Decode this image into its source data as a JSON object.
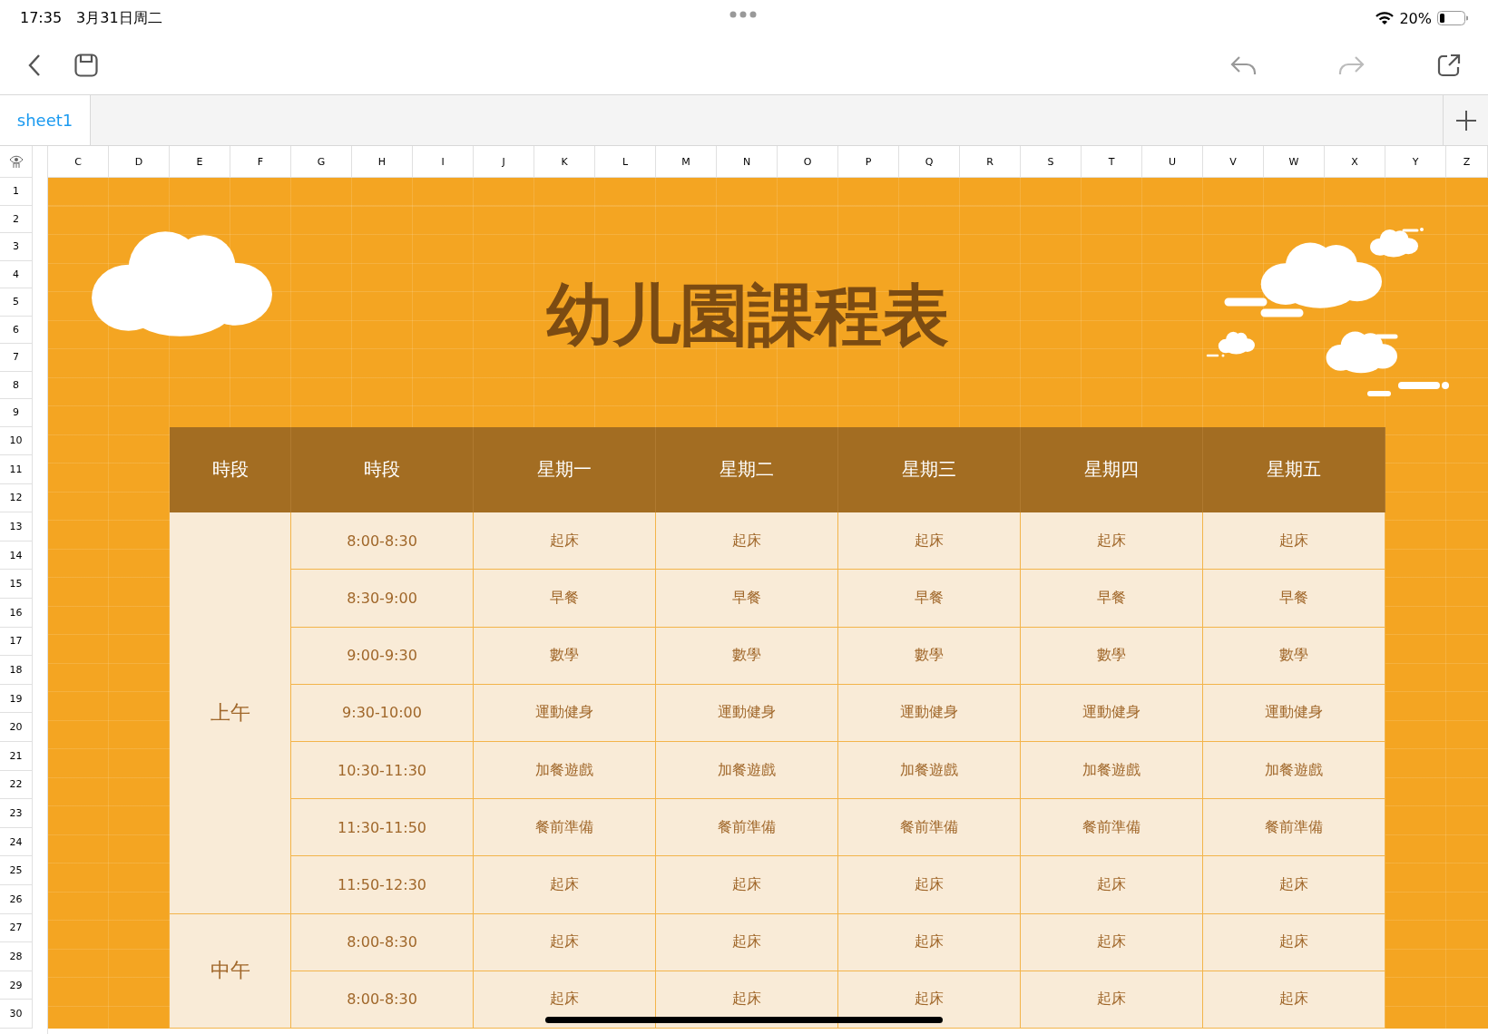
{
  "status_bar": {
    "time": "17:35",
    "date": "3月31日周二",
    "battery": "20%"
  },
  "sheet_tabs": [
    {
      "label": "sheet1",
      "selected": true
    }
  ],
  "column_headers": [
    "C",
    "D",
    "E",
    "F",
    "G",
    "H",
    "I",
    "J",
    "K",
    "L",
    "M",
    "N",
    "O",
    "P",
    "Q",
    "R",
    "S",
    "T",
    "U",
    "V",
    "W",
    "X",
    "Y",
    "Z"
  ],
  "row_headers": [
    "1",
    "2",
    "3",
    "4",
    "5",
    "6",
    "7",
    "8",
    "9",
    "10",
    "11",
    "12",
    "13",
    "14",
    "15",
    "16",
    "17",
    "18",
    "19",
    "20",
    "21",
    "22",
    "23",
    "24",
    "25",
    "26",
    "27",
    "28",
    "29",
    "30"
  ],
  "title": "幼儿園課程表",
  "schedule": {
    "columns": [
      "時段",
      "時段",
      "星期一",
      "星期二",
      "星期三",
      "星期四",
      "星期五"
    ],
    "periods": [
      {
        "label": "上午",
        "slots": [
          {
            "time": "8:00-8:30",
            "activities": [
              "起床",
              "起床",
              "起床",
              "起床",
              "起床"
            ]
          },
          {
            "time": "8:30-9:00",
            "activities": [
              "早餐",
              "早餐",
              "早餐",
              "早餐",
              "早餐"
            ]
          },
          {
            "time": "9:00-9:30",
            "activities": [
              "數學",
              "數學",
              "數學",
              "數學",
              "數學"
            ]
          },
          {
            "time": "9:30-10:00",
            "activities": [
              "運動健身",
              "運動健身",
              "運動健身",
              "運動健身",
              "運動健身"
            ]
          },
          {
            "time": "10:30-11:30",
            "activities": [
              "加餐遊戲",
              "加餐遊戲",
              "加餐遊戲",
              "加餐遊戲",
              "加餐遊戲"
            ]
          },
          {
            "time": "11:30-11:50",
            "activities": [
              "餐前準備",
              "餐前準備",
              "餐前準備",
              "餐前準備",
              "餐前準備"
            ]
          },
          {
            "time": "11:50-12:30",
            "activities": [
              "起床",
              "起床",
              "起床",
              "起床",
              "起床"
            ]
          }
        ]
      },
      {
        "label": "中午",
        "slots": [
          {
            "time": "8:00-8:30",
            "activities": [
              "起床",
              "起床",
              "起床",
              "起床",
              "起床"
            ]
          },
          {
            "time": "8:00-8:30",
            "activities": [
              "起床",
              "起床",
              "起床",
              "起床",
              "起床"
            ]
          }
        ]
      }
    ]
  }
}
